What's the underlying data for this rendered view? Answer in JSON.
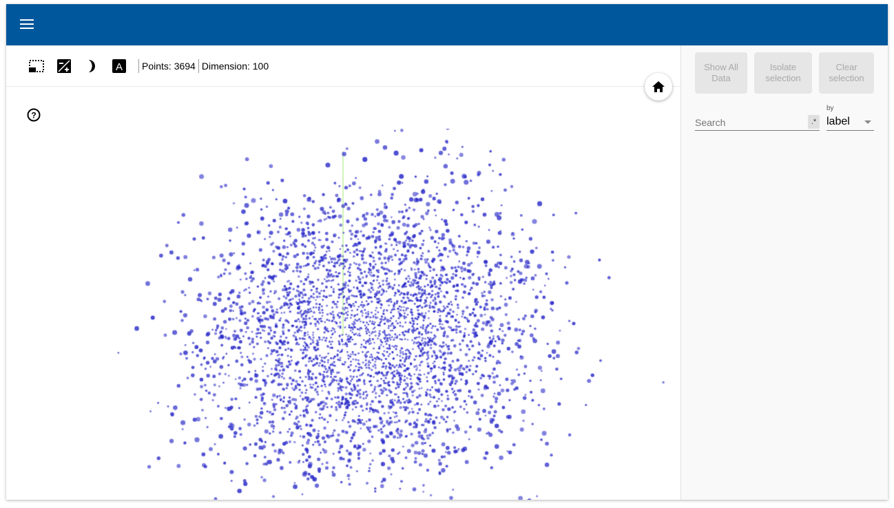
{
  "header": {
    "menu_icon": "hamburger-menu-icon",
    "color": "#01579b"
  },
  "toolbar": {
    "icons": [
      "bounding-box-select-icon",
      "night-mode-exposure-icon",
      "moon-icon",
      "label-text-icon"
    ],
    "points_label": "Points: 3694",
    "dimension_label": "Dimension: 100"
  },
  "plot": {
    "point_color": "#3f3fd0",
    "line_color": "#9ee86a",
    "home_icon": "home-icon",
    "help_icon": "help-icon"
  },
  "sidebar": {
    "show_all": "Show All Data",
    "isolate": "Isolate selection",
    "clear": "Clear selection",
    "search_placeholder": "Search",
    "regex_label": ".*",
    "by_label": "by",
    "by_value": "label"
  }
}
